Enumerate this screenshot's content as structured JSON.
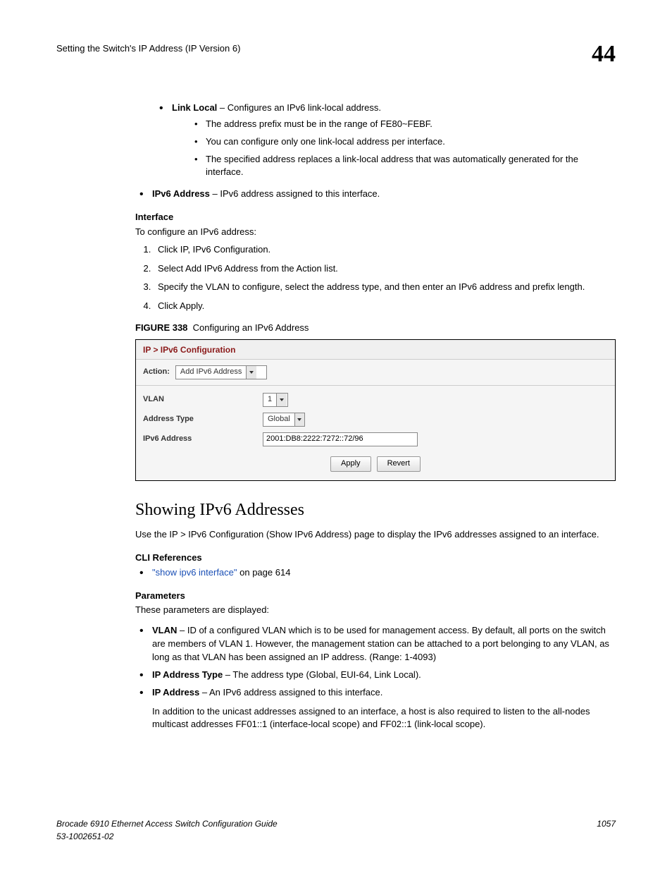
{
  "header": {
    "running_title": "Setting the Switch's IP Address (IP Version 6)",
    "chapter": "44"
  },
  "top_bullets": {
    "link_local": {
      "label": "Link Local",
      "desc": " – Configures an IPv6 link-local address.",
      "subs": [
        "The address prefix must be in the range of FE80~FEBF.",
        "You can configure only one link-local address per interface.",
        "The specified address replaces a link-local address that was automatically generated for the interface."
      ]
    },
    "ipv6_address": {
      "label": "IPv6 Address",
      "desc": " – IPv6 address assigned to this interface."
    }
  },
  "interface": {
    "heading": "Interface",
    "intro": "To configure an IPv6 address:",
    "steps": [
      "Click IP, IPv6 Configuration.",
      "Select Add IPv6 Address from the Action list.",
      "Specify the VLAN to configure, select the address type, and then enter an IPv6 address and prefix length.",
      "Click Apply."
    ]
  },
  "figure": {
    "code": "FIGURE 338",
    "caption": "Configuring an IPv6 Address",
    "breadcrumb": "IP > IPv6 Configuration",
    "action_label": "Action:",
    "action_value": "Add IPv6 Address",
    "vlan_label": "VLAN",
    "vlan_value": "1",
    "addr_type_label": "Address Type",
    "addr_type_value": "Global",
    "ipv6_label": "IPv6 Address",
    "ipv6_value": "2001:DB8:2222:7272::72/96",
    "apply": "Apply",
    "revert": "Revert"
  },
  "showing": {
    "title": "Showing IPv6 Addresses",
    "intro": "Use the IP > IPv6 Configuration (Show IPv6 Address) page to display the IPv6 addresses assigned to an interface.",
    "cli_heading": "CLI References",
    "cli_link": "\"show ipv6 interface\"",
    "cli_tail": " on page 614",
    "params_heading": "Parameters",
    "params_intro": "These parameters are displayed:",
    "params": {
      "vlan": {
        "label": "VLAN",
        "desc": " – ID of a configured VLAN which is to be used for management access. By default, all ports on the switch are members of VLAN 1. However, the management station can be attached to a port belonging to any VLAN, as long as that VLAN has been assigned an IP address. (Range: 1-4093)"
      },
      "ip_type": {
        "label": "IP Address Type",
        "desc": " – The address type (Global, EUI-64, Link Local)."
      },
      "ip_addr": {
        "label": "IP Address",
        "desc": " – An IPv6 address assigned to this interface.",
        "extra": "In addition to the unicast addresses assigned to an interface, a host is also required to listen to the all-nodes multicast addresses FF01::1 (interface-local scope) and FF02::1 (link-local scope)."
      }
    }
  },
  "footer": {
    "doc_title": "Brocade 6910 Ethernet Access Switch Configuration Guide",
    "doc_number": "53-1002651-02",
    "page": "1057"
  }
}
